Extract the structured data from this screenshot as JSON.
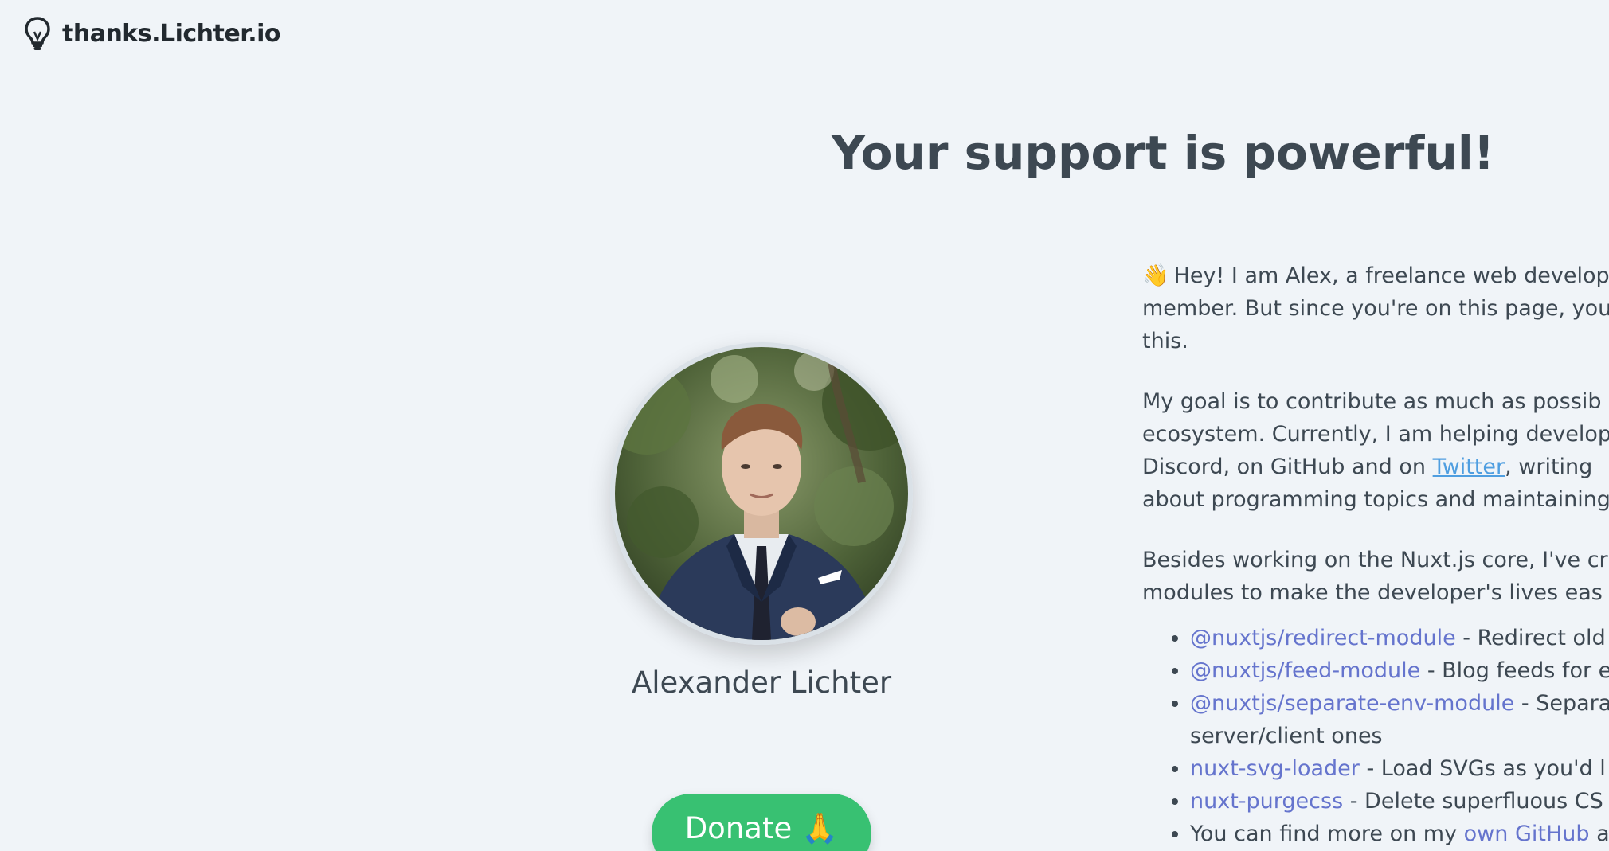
{
  "header": {
    "brand": "thanks.Lichter.io",
    "icon": "lightbulb-icon"
  },
  "hero": {
    "title": "Your support is powerful!"
  },
  "profile": {
    "name": "Alexander Lichter",
    "avatar": "profile-photo",
    "donate_label": "Donate",
    "donate_emoji": "🙏",
    "donate_color": "#38c172"
  },
  "content": {
    "intro_emoji": "👋",
    "intro_lines": [
      "Hey! I am Alex, a freelance web develop",
      "member. But since you're on this page, you",
      "this."
    ],
    "goal": {
      "line1": "My goal is to contribute as much as possib",
      "line2": "ecosystem. Currently, I am helping develop",
      "line3_before": "Discord, on GitHub and on ",
      "twitter_link": "Twitter",
      "line3_after": ", writing",
      "line4": "about programming topics and maintaining"
    },
    "modules_intro": [
      "Besides working on the Nuxt.js core, I've cr",
      "modules to make the developer's lives eas"
    ],
    "modules": [
      {
        "link": "@nuxtjs/redirect-module",
        "desc": " - Redirect old"
      },
      {
        "link": "@nuxtjs/feed-module",
        "desc": " - Blog feeds for e"
      },
      {
        "link": "@nuxtjs/separate-env-module",
        "desc": " - Separa",
        "desc2": "server/client ones"
      },
      {
        "link": "nuxt-svg-loader",
        "desc": " - Load SVGs as you'd l"
      },
      {
        "link": "nuxt-purgecss",
        "desc": " - Delete superfluous CS"
      }
    ],
    "more": {
      "before": "You can find more on my ",
      "link": "own GitHub",
      "after": " a"
    }
  },
  "colors": {
    "background": "#f0f4f8",
    "text": "#3d4852",
    "link": "#6574cd",
    "twitter_link": "#3490dc"
  }
}
